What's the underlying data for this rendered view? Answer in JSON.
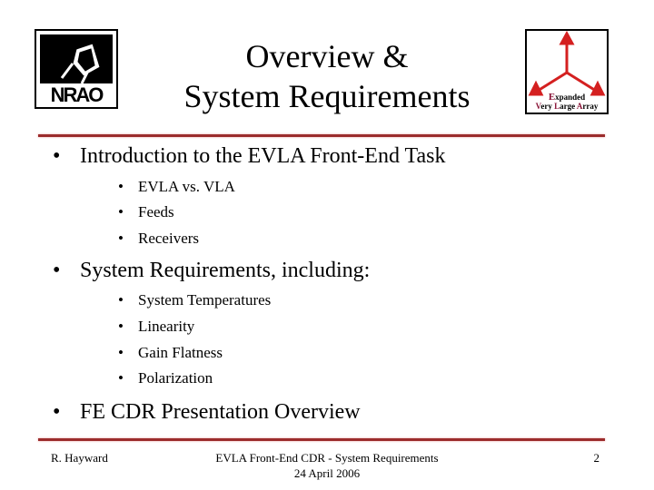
{
  "header": {
    "title_line1": "Overview &",
    "title_line2": "System Requirements",
    "left_logo": {
      "icon": "nrao-logo",
      "text": "NRAO"
    },
    "right_logo": {
      "icon": "evla-logo",
      "line1": "Expanded",
      "line2": "Very Large Array",
      "arrow_color": "#d42020",
      "accent_color": "#8a1538"
    }
  },
  "accent_color": "#9b2c2c",
  "bullets": [
    {
      "label": "Introduction to the EVLA Front-End Task",
      "sub": [
        "EVLA vs. VLA",
        "Feeds",
        "Receivers"
      ]
    },
    {
      "label": "System Requirements, including:",
      "sub": [
        "System Temperatures",
        "Linearity",
        "Gain Flatness",
        "Polarization"
      ]
    },
    {
      "label": "FE CDR Presentation Overview",
      "sub": []
    }
  ],
  "bullet_glyph": "•",
  "footer": {
    "author": "R. Hayward",
    "center_line1": "EVLA Front-End CDR - System Requirements",
    "center_line2": "24 April 2006",
    "page_number": "2"
  }
}
